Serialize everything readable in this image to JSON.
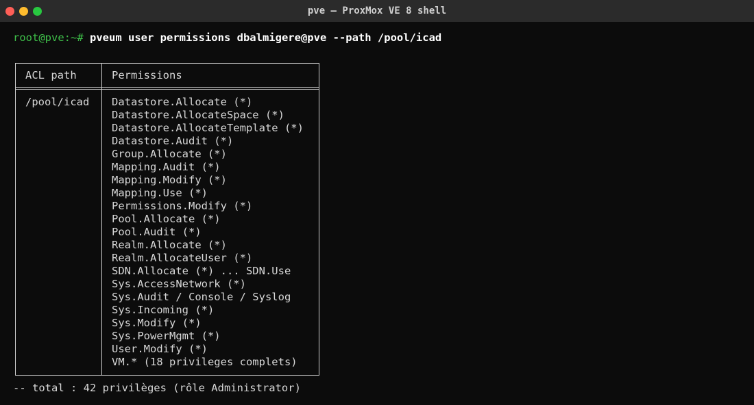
{
  "window": {
    "title": "pve — ProxMox VE 8 shell",
    "traffic_lights": {
      "close": "#ff5f57",
      "minimize": "#febc2e",
      "maximize": "#28c840"
    }
  },
  "terminal": {
    "prompt": "root@pve:~#",
    "command": "pveum user permissions dbalmigere@pve --path /pool/icad",
    "table": {
      "headers": [
        "ACL path",
        "Permissions"
      ],
      "acl_path": "/pool/icad",
      "permissions": [
        "Datastore.Allocate (*)",
        "Datastore.AllocateSpace (*)",
        "Datastore.AllocateTemplate (*)",
        "Datastore.Audit (*)",
        "Group.Allocate (*)",
        "Mapping.Audit (*)",
        "Mapping.Modify (*)",
        "Mapping.Use (*)",
        "Permissions.Modify (*)",
        "Pool.Allocate (*)",
        "Pool.Audit (*)",
        "Realm.Allocate (*)",
        "Realm.AllocateUser (*)",
        "SDN.Allocate (*) ... SDN.Use",
        "Sys.AccessNetwork (*)",
        "Sys.Audit / Console / Syslog",
        "Sys.Incoming (*)",
        "Sys.Modify (*)",
        "Sys.PowerMgmt (*)",
        "User.Modify (*)",
        "VM.* (18 privileges complets)"
      ]
    },
    "footer": "-- total : 42 privilèges (rôle Administrator)"
  }
}
